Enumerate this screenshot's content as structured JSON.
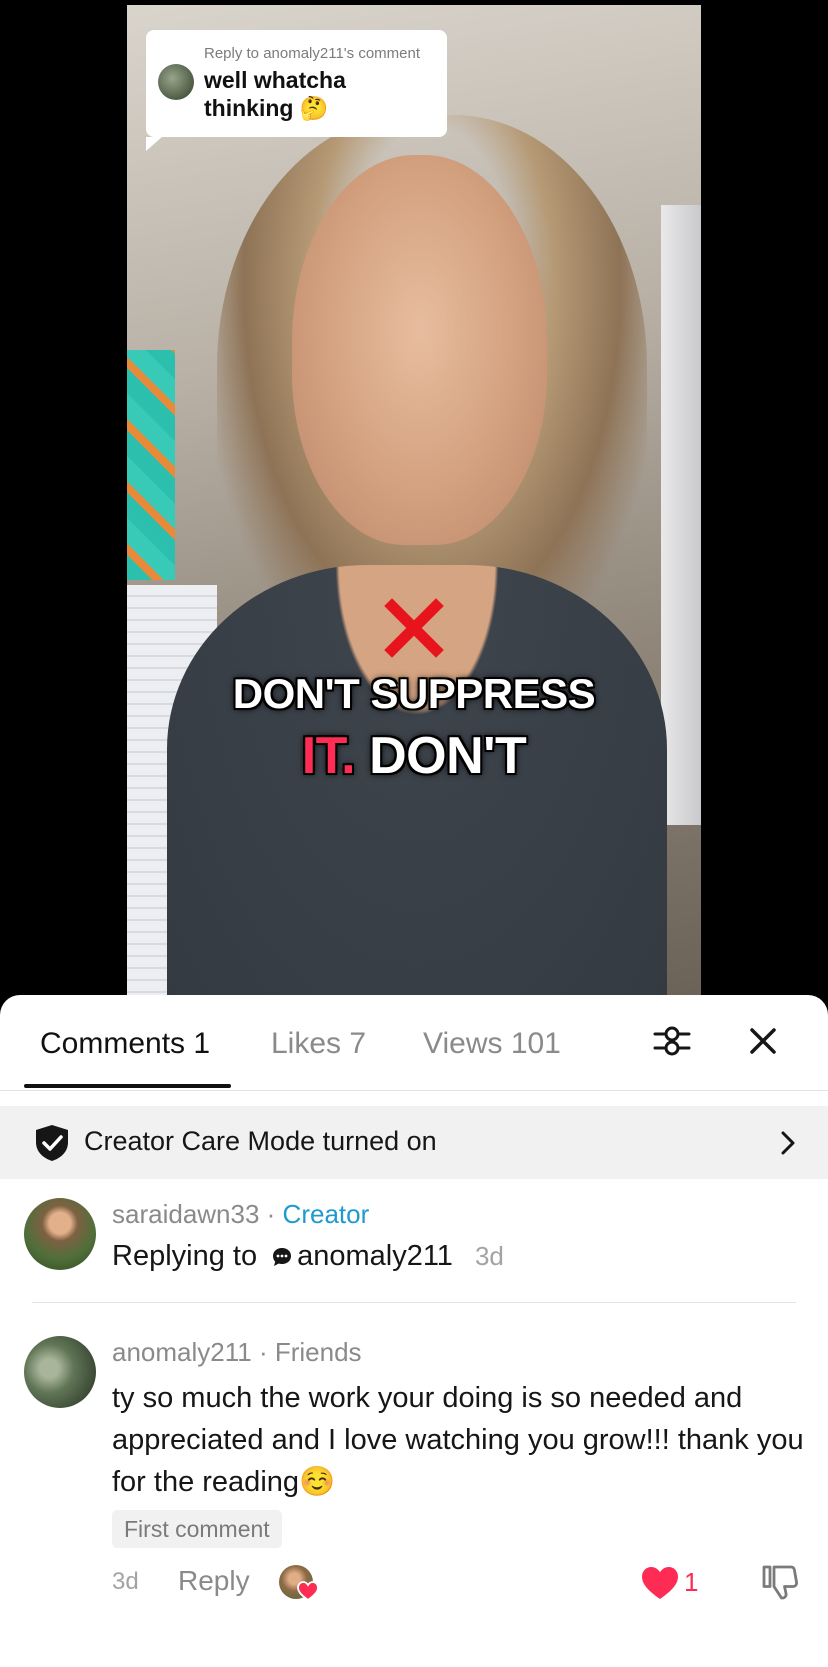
{
  "video": {
    "reply_bubble": {
      "meta": "Reply to anomaly211's comment",
      "text": "well whatcha thinking 🤔"
    },
    "caption": {
      "line1": "DON'T SUPPRESS",
      "line2_highlight": "IT.",
      "line2_rest": " DON'T"
    }
  },
  "tabs": {
    "comments": "Comments 1",
    "likes": "Likes 7",
    "views": "Views 101"
  },
  "icons": {
    "filter": "filter-sliders-icon",
    "close": "close-icon",
    "shield": "shield-check-icon",
    "chevron": "chevron-right-icon",
    "comment_bubble": "comment-bubble-icon",
    "heart": "heart-icon",
    "dislike": "thumbs-down-icon"
  },
  "care_banner": {
    "text": "Creator Care Mode turned on"
  },
  "comments": [
    {
      "username": "saraidawn33",
      "separator": " · ",
      "tag": "Creator",
      "replying_prefix": "Replying to",
      "replying_user": "anomaly211",
      "time": "3d"
    },
    {
      "username": "anomaly211",
      "separator": " · ",
      "tag": "Friends",
      "text": "ty so much the work your doing is so needed and appreciated and I love watching you grow!!! thank you for the reading☺️",
      "badge": "First comment",
      "time": "3d",
      "reply_label": "Reply",
      "like_count": "1"
    }
  ],
  "colors": {
    "accent_creator": "#1f9ad1",
    "like_red": "#fe2c55",
    "caption_highlight": "#ff2d55"
  }
}
